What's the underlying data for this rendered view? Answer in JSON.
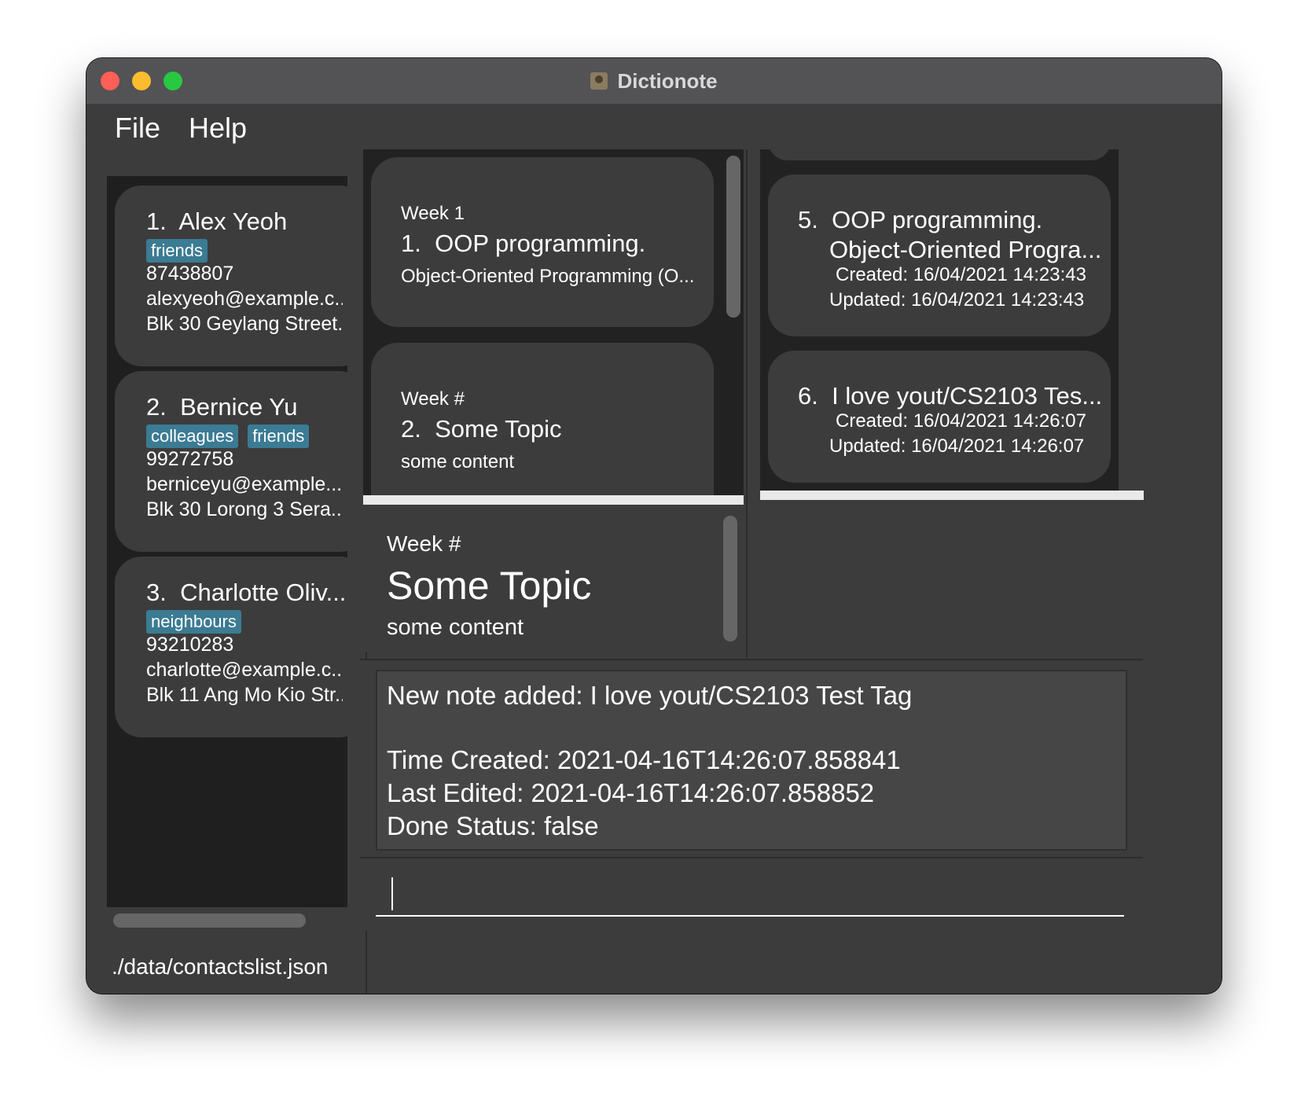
{
  "window": {
    "title": "Dictionote"
  },
  "menu": {
    "file": "File",
    "help": "Help"
  },
  "contacts": [
    {
      "index": "1.",
      "name": "Alex Yeoh",
      "tags": [
        "friends"
      ],
      "phone": "87438807",
      "email": "alexyeoh@example.c...",
      "address": "Blk 30 Geylang Street..."
    },
    {
      "index": "2.",
      "name": "Bernice Yu",
      "tags": [
        "colleagues",
        "friends"
      ],
      "phone": "99272758",
      "email": "berniceyu@example....",
      "address": "Blk 30 Lorong 3 Sera..."
    },
    {
      "index": "3.",
      "name": "Charlotte Oliv...",
      "tags": [
        "neighbours"
      ],
      "phone": "93210283",
      "email": "charlotte@example.c...",
      "address": "Blk 11 Ang Mo Kio Str..."
    }
  ],
  "status_bar": {
    "file_path": "./data/contactslist.json"
  },
  "notes_list": [
    {
      "week": "Week 1",
      "index": "1.",
      "title": "OOP programming.",
      "content": "Object-Oriented Programming (O..."
    },
    {
      "week": "Week #",
      "index": "2.",
      "title": "Some Topic",
      "content": "some content"
    }
  ],
  "note_detail": {
    "week": "Week #",
    "title": "Some Topic",
    "content": "some content"
  },
  "right_notes": [
    {
      "index": "5.",
      "title_line1": "OOP programming.",
      "title_line2": "Object-Oriented Progra...",
      "created": "Created: 16/04/2021 14:23:43",
      "updated": "Updated: 16/04/2021 14:23:43"
    },
    {
      "index": "6.",
      "title_line1": "I love yout/CS2103 Tes...",
      "created": "Created: 16/04/2021 14:26:07",
      "updated": "Updated: 16/04/2021 14:26:07"
    }
  ],
  "result": {
    "line1": "New note added: I love yout/CS2103 Test Tag",
    "line2": "Time Created: 2021-04-16T14:26:07.858841",
    "line3": "Last Edited: 2021-04-16T14:26:07.858852",
    "line4": "Done Status: false"
  },
  "command": {
    "value": ""
  },
  "colors": {
    "tag": "#3b7b93",
    "card": "#3c3c3c",
    "list_bg": "#1f1f1f"
  }
}
